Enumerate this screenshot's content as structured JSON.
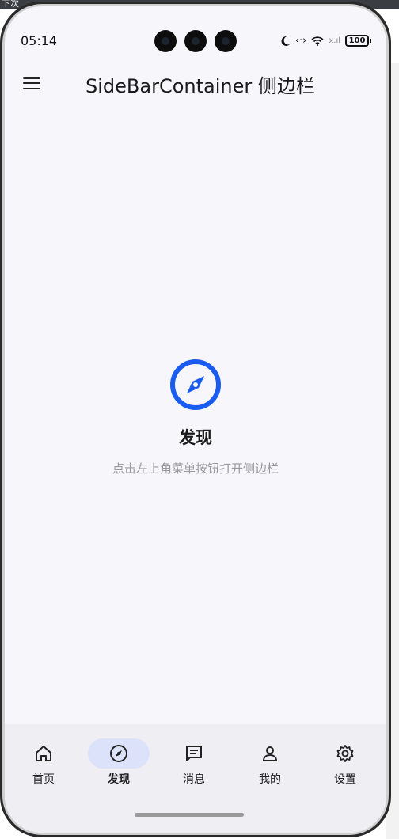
{
  "window": {
    "top_strip_text": "下次"
  },
  "status_bar": {
    "time": "05:14",
    "battery": "100",
    "signal_text": "x.ıl"
  },
  "app_bar": {
    "title": "SideBarContainer 侧边栏"
  },
  "content": {
    "heading": "发现",
    "hint": "点击左上角菜单按钮打开侧边栏",
    "icon": "compass-icon",
    "accent_color": "#1a5cf0"
  },
  "bottom_nav": {
    "items": [
      {
        "label": "首页",
        "icon": "home-icon"
      },
      {
        "label": "发现",
        "icon": "compass-icon",
        "active": true
      },
      {
        "label": "消息",
        "icon": "message-icon"
      },
      {
        "label": "我的",
        "icon": "person-icon"
      },
      {
        "label": "设置",
        "icon": "gear-icon"
      }
    ],
    "active_color": "#dde2fb"
  }
}
